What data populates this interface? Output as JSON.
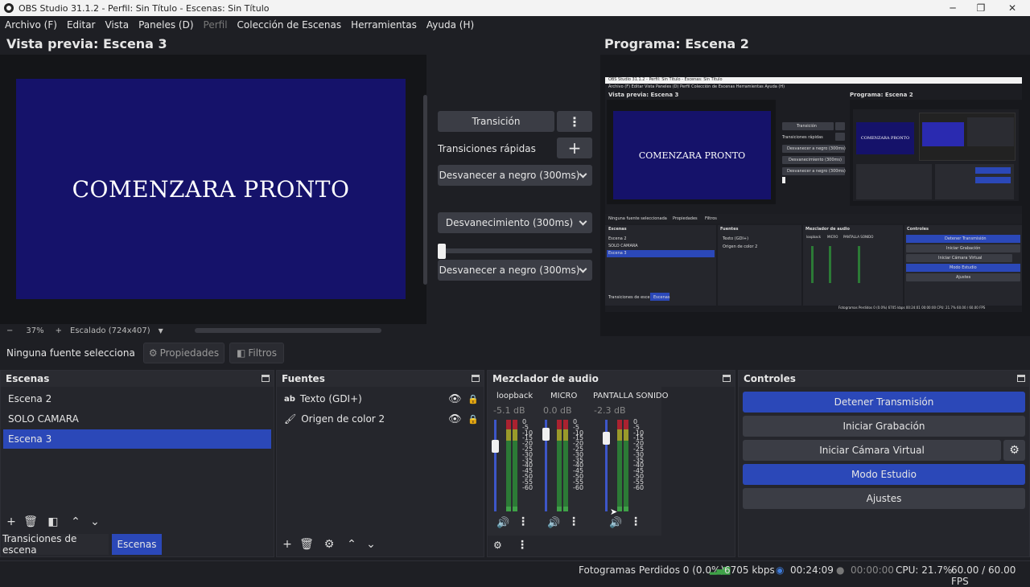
{
  "window": {
    "title": "OBS Studio 31.1.2 - Perfil: Sin Título - Escenas: Sin Título",
    "min": "─",
    "max": "❐",
    "close": "✕"
  },
  "menu": {
    "items": [
      "Archivo (F)",
      "Editar",
      "Vista",
      "Paneles (D)",
      "Perfil",
      "Colección de Escenas",
      "Herramientas",
      "Ayuda (H)"
    ]
  },
  "preview": {
    "title": "Vista previa: Escena 3",
    "canvas_text": "COMENZARA PRONTO",
    "zoom_minus": "−",
    "zoom": "37%",
    "zoom_plus": "+",
    "scale_label": "Escalado (724x407)"
  },
  "program": {
    "title": "Programa: Escena 2"
  },
  "transition": {
    "button": "Transición",
    "quick_label": "Transiciones rápidas",
    "quick": [
      "Desvanecer a negro (300ms)",
      "Desvanecimiento (300ms)",
      "Desvanecer a negro (300ms)"
    ],
    "tbar_value": 0
  },
  "source_bar": {
    "status": "Ninguna fuente selecciona",
    "props": "Propiedades",
    "filters": "Filtros"
  },
  "scenes": {
    "title": "Escenas",
    "items": [
      "Escena 2",
      "SOLO CAMARA",
      "Escena 3"
    ],
    "active": "Escena 3",
    "tab1": "Transiciones de escena",
    "tab2": "Escenas"
  },
  "sources": {
    "title": "Fuentes",
    "items": [
      {
        "name": "Texto (GDI+)",
        "icon": "text-icon"
      },
      {
        "name": "Origen de color 2",
        "icon": "brush-icon"
      }
    ]
  },
  "mixer": {
    "title": "Mezclador de audio",
    "scale": [
      "0",
      "-5",
      "-10",
      "-15",
      "-20",
      "-25",
      "-30",
      "-35",
      "-40",
      "-45",
      "-50",
      "-55",
      "-60"
    ],
    "channels": [
      {
        "name": "loopback",
        "db": "-5.1 dB",
        "level": 0.75
      },
      {
        "name": "MICRO",
        "db": "0.0 dB",
        "level": 0.9
      },
      {
        "name": "PANTALLA SONIDO",
        "db": "-2.3 dB",
        "level": 0.85
      }
    ]
  },
  "controls": {
    "title": "Controles",
    "stop_stream": "Detener Transmisión",
    "start_rec": "Iniciar Grabación",
    "virtual_cam": "Iniciar Cámara Virtual",
    "studio": "Modo Estudio",
    "settings": "Ajustes"
  },
  "status": {
    "dropped": "Fotogramas Perdidos 0 (0.0%)",
    "kbps": "6705 kbps",
    "live_time": "00:24:09",
    "rec_time": "00:00:00",
    "cpu": "CPU: 21.7%",
    "fps": "60.00 / 60.00 FPS"
  },
  "mini": {
    "title": "OBS Studio 31.1.2 - Perfil: Sin Título - Escenas: Sin Título",
    "menu": "Archivo (F)   Editar   Vista   Paneles (D)   Perfil   Colección de Escenas   Herramientas   Ayuda (H)",
    "preview_title": "Vista previa: Escena 3",
    "program_title": "Programa: Escena 2",
    "canvas_text": "COMENZARA PRONTO",
    "transition": "Transición",
    "quick_label": "Transiciones rápidas",
    "quick": [
      "Desvanecer a negro (300ms)",
      "Desvanecimiento (300ms)",
      "Desvanecer a negro (300ms)"
    ],
    "status_line": "Ninguna fuente seleccionada",
    "props": "Propiedades",
    "filters": "Filtros",
    "scenes_title": "Escenas",
    "scenes": [
      "Escena 2",
      "SOLO CAMARA",
      "Escena 3"
    ],
    "sources_title": "Fuentes",
    "sources": [
      "Texto (GDI+)",
      "Origen de color 2"
    ],
    "mixer_title": "Mezclador de audio",
    "mixer_names": [
      "loopback",
      "MICRO",
      "PANTALLA SONIDO"
    ],
    "controls_title": "Controles",
    "controls": [
      "Detener Transmisión",
      "Iniciar Grabación",
      "Iniciar Cámara Virtual",
      "Modo Estudio",
      "Ajustes"
    ],
    "tab1": "Transiciones de escena",
    "tab2": "Escenas",
    "status_right": "Fotogramas Perdidos 0 (0.0%)   6705 kbps   00:24:01   00:00:00   CPU: 21.7%   60.00 / 60.00 FPS"
  }
}
